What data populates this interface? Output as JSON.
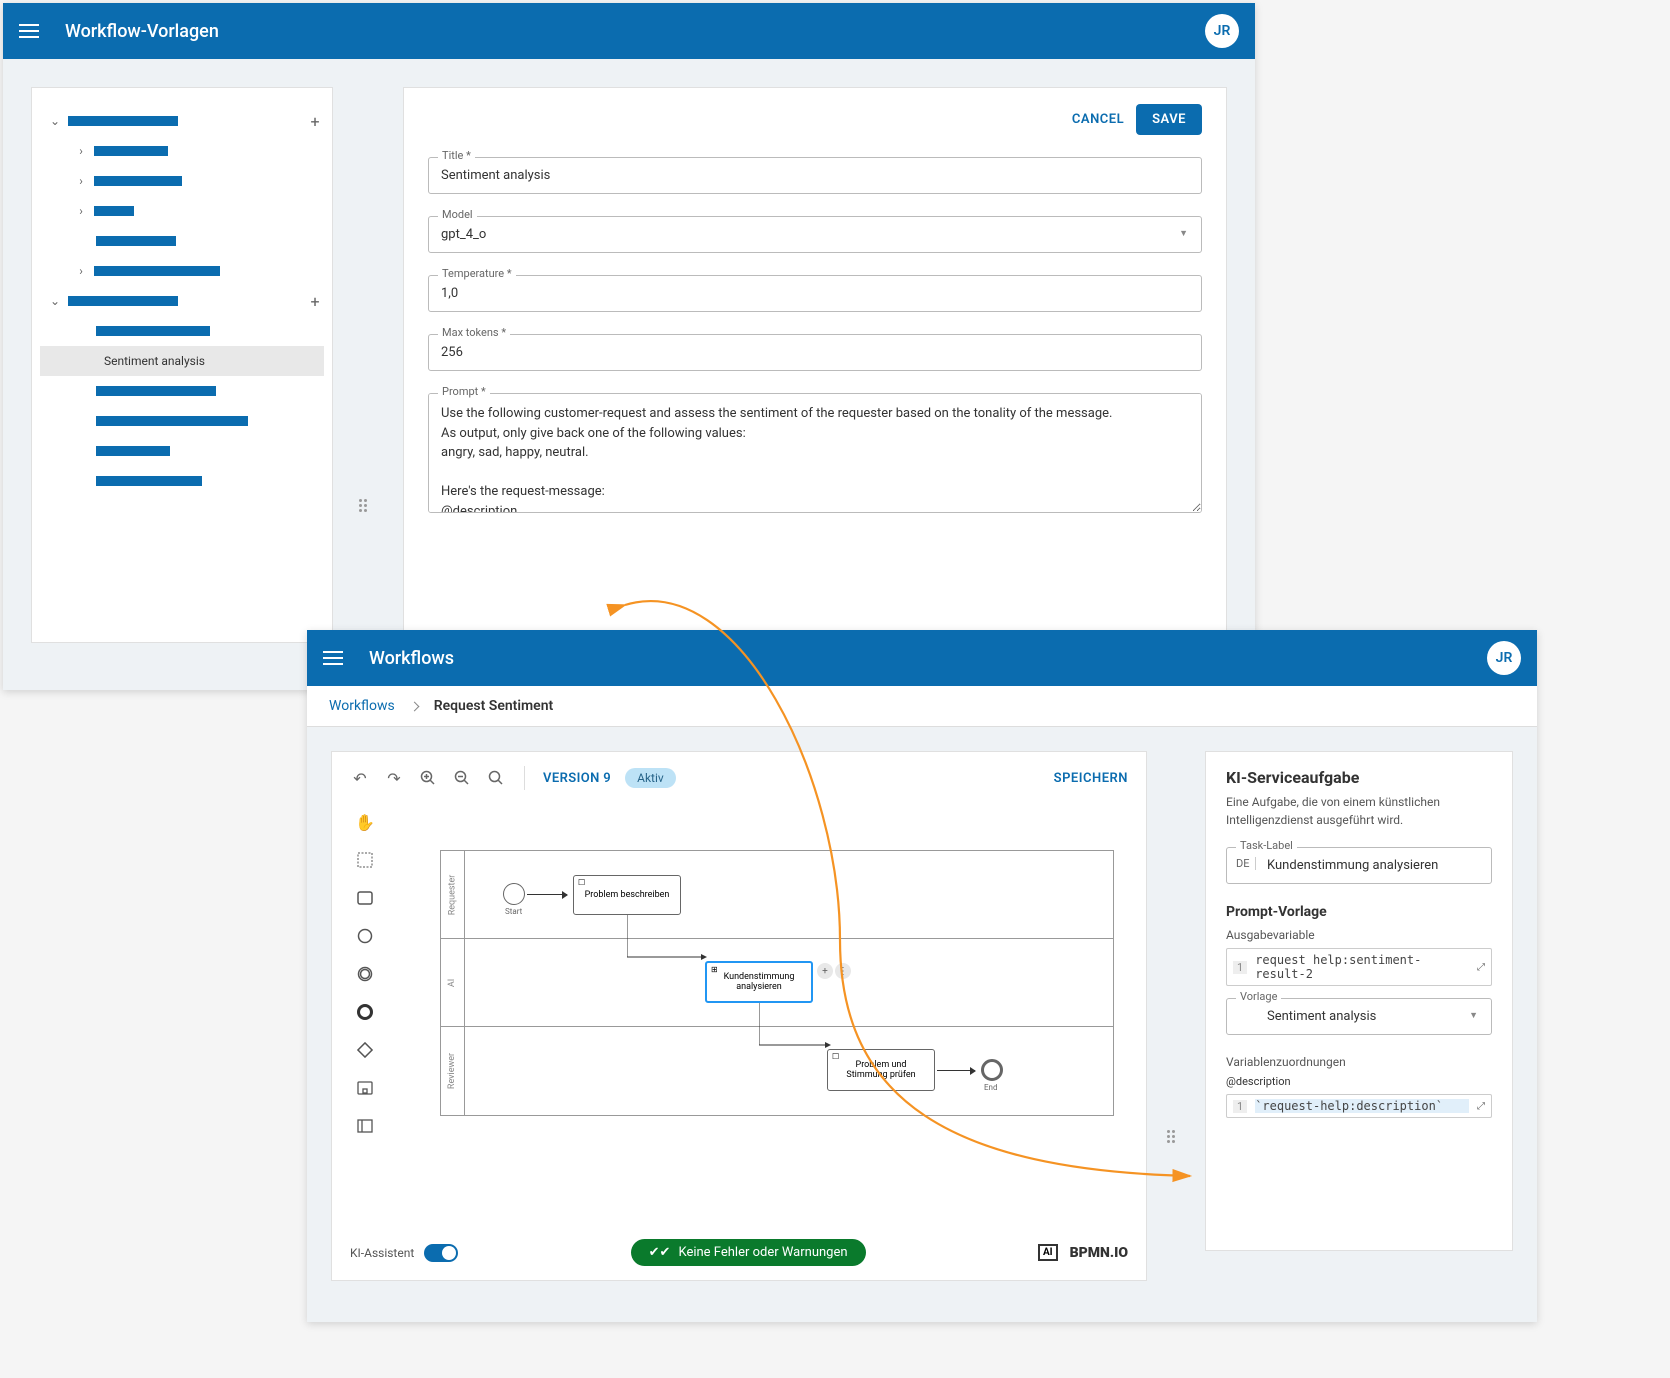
{
  "win1": {
    "header_title": "Workflow-Vorlagen",
    "avatar": "JR",
    "actions": {
      "cancel": "CANCEL",
      "save": "SAVE"
    },
    "tree": {
      "selected_label": "Sentiment analysis"
    },
    "form": {
      "title_label": "Title *",
      "title_value": "Sentiment analysis",
      "model_label": "Model",
      "model_value": "gpt_4_o",
      "temperature_label": "Temperature *",
      "temperature_value": "1,0",
      "maxtokens_label": "Max tokens *",
      "maxtokens_value": "256",
      "prompt_label": "Prompt *",
      "prompt_value": "Use the following customer-request and assess the sentiment of the requester based on the tonality of the message.\nAs output, only give back one of the following values:\nangry, sad, happy, neutral.\n\nHere's the request-message:\n@description"
    }
  },
  "win2": {
    "header_title": "Workflows",
    "avatar": "JR",
    "breadcrumbs": {
      "root": "Workflows",
      "current": "Request Sentiment"
    },
    "toolbar": {
      "version": "VERSION 9",
      "status": "Aktiv",
      "save": "SPEICHERN"
    },
    "lanes": {
      "l1": "Requester",
      "l2": "AI",
      "l3": "Reviewer"
    },
    "nodes": {
      "start_lbl": "Start",
      "end_lbl": "End",
      "t1": "Problem beschreiben",
      "t2": "Kundenstimmung analysieren",
      "t3": "Problem und Stimmung prüfen"
    },
    "footer": {
      "assistant_label": "KI-Assistent",
      "status_text": "Keine Fehler oder Warnungen",
      "brand_ai": "AI",
      "brand_bpmn": "BPMN.IO"
    },
    "inspector": {
      "title": "KI-Serviceaufgabe",
      "desc": "Eine Aufgabe, die von einem künstlichen Intelligenzdienst ausgeführt wird.",
      "task_label_lbl": "Task-Label",
      "task_label_lang": "DE",
      "task_label_val": "Kundenstimmung analysieren",
      "prompt_section": "Prompt-Vorlage",
      "output_var_lbl": "Ausgabevariable",
      "output_var_val": "request help:sentiment-result-2",
      "vorlage_lbl": "Vorlage",
      "vorlage_val": "Sentiment analysis",
      "mappings_lbl": "Variablenzuordnungen",
      "map_key": "@description",
      "map_val": "`request-help:description`"
    }
  }
}
